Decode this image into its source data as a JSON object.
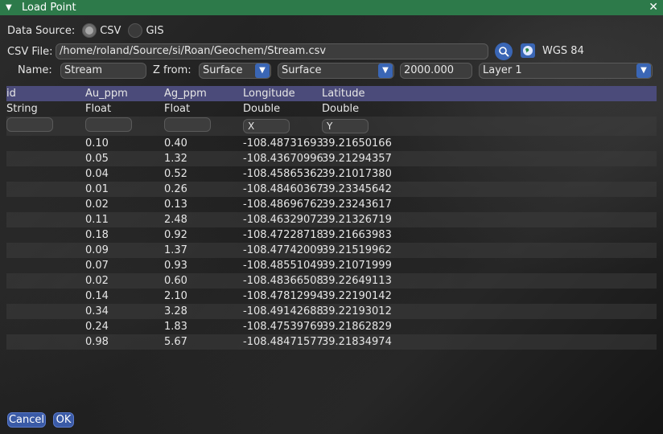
{
  "window": {
    "title": "Load Point"
  },
  "source": {
    "label": "Data Source:",
    "options": [
      "CSV",
      "GIS"
    ],
    "selected": "CSV"
  },
  "csv": {
    "label": "CSV File:",
    "path": "/home/roland/Source/si/Roan/Geochem/Stream.csv",
    "crs": "WGS 84"
  },
  "settings": {
    "name_label": "Name:",
    "name_value": "Stream",
    "zfrom_label": "Z from:",
    "zfrom_value": "Surface",
    "zsurface_value": "Surface",
    "zoffset_value": "2000.000",
    "layer_value": "Layer 1"
  },
  "table": {
    "headers": [
      "id",
      "Au_ppm",
      "Ag_ppm",
      "Longitude",
      "Latitude"
    ],
    "types": [
      "String",
      "Float",
      "Float",
      "Double",
      "Double"
    ],
    "mapping": [
      "",
      "",
      "",
      "X",
      "Y"
    ],
    "rows": [
      [
        "",
        "0.10",
        "0.40",
        "-108.48731693",
        "39.21650166"
      ],
      [
        "",
        "0.05",
        "1.32",
        "-108.43670996",
        "39.21294357"
      ],
      [
        "",
        "0.04",
        "0.52",
        "-108.45865362",
        "39.21017380"
      ],
      [
        "",
        "0.01",
        "0.26",
        "-108.48460367",
        "39.23345642"
      ],
      [
        "",
        "0.02",
        "0.13",
        "-108.48696762",
        "39.23243617"
      ],
      [
        "",
        "0.11",
        "2.48",
        "-108.46329072",
        "39.21326719"
      ],
      [
        "",
        "0.18",
        "0.92",
        "-108.47228718",
        "39.21663983"
      ],
      [
        "",
        "0.09",
        "1.37",
        "-108.47742009",
        "39.21519962"
      ],
      [
        "",
        "0.07",
        "0.93",
        "-108.48551049",
        "39.21071999"
      ],
      [
        "",
        "0.02",
        "0.60",
        "-108.48366508",
        "39.22649113"
      ],
      [
        "",
        "0.14",
        "2.10",
        "-108.47812994",
        "39.22190142"
      ],
      [
        "",
        "0.34",
        "3.28",
        "-108.49142688",
        "39.22193012"
      ],
      [
        "",
        "0.24",
        "1.83",
        "-108.47539769",
        "39.21862829"
      ],
      [
        "",
        "0.98",
        "5.67",
        "-108.48471577",
        "39.21834974"
      ]
    ]
  },
  "buttons": {
    "cancel": "Cancel",
    "ok": "OK"
  },
  "icons": {
    "search": "search-icon",
    "globe": "globe-icon",
    "close": "close-icon",
    "collapse": "collapse-triangle-icon"
  },
  "colors": {
    "titlebar": "#2d7a4a",
    "accent": "#3a66b5",
    "header_row": "#4b4b7a"
  }
}
